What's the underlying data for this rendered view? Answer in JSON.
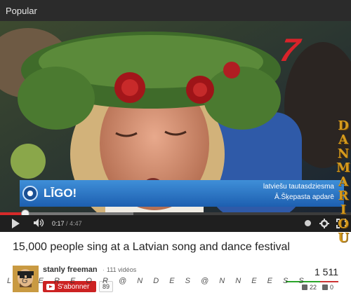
{
  "header": {
    "label": "Popular"
  },
  "video": {
    "channel_logo": "7",
    "lower_third": {
      "title": "LĪGO!",
      "subtitle_line1": "latviešu tautasdziesma",
      "subtitle_line2": "Ā.Šķepasta apdarē"
    },
    "progress": {
      "played_fraction": 0.072,
      "loaded_fraction": 0.38
    },
    "controls": {
      "current_time": "0:17",
      "separator": "/",
      "duration": "4:47"
    }
  },
  "info": {
    "title": "15,000 people sing at a Latvian song and dance festival",
    "channel_name": "stanly freeman",
    "videos_count": "111 vidéos",
    "subscribe_label": "S'abonner",
    "subscriber_count": "89",
    "views": "1 511",
    "likes": "22",
    "dislikes": "0",
    "likes_fraction": 0.65
  },
  "watermarks": {
    "side": [
      "D",
      "A",
      "N",
      "M",
      "A",
      "R",
      "I",
      "O",
      "U"
    ],
    "bottom": "L G E R    E  O R @ N  D E S  @ N N E E S  S"
  },
  "colors": {
    "accent_red": "#cc2222",
    "lower_third_blue": "#2b74c6",
    "watermark_gold": "#d49a1e"
  },
  "icons": [
    "play-icon",
    "volume-icon",
    "info-icon",
    "gear-icon",
    "fullscreen-icon",
    "youtube-icon",
    "like-icon",
    "dislike-icon"
  ]
}
